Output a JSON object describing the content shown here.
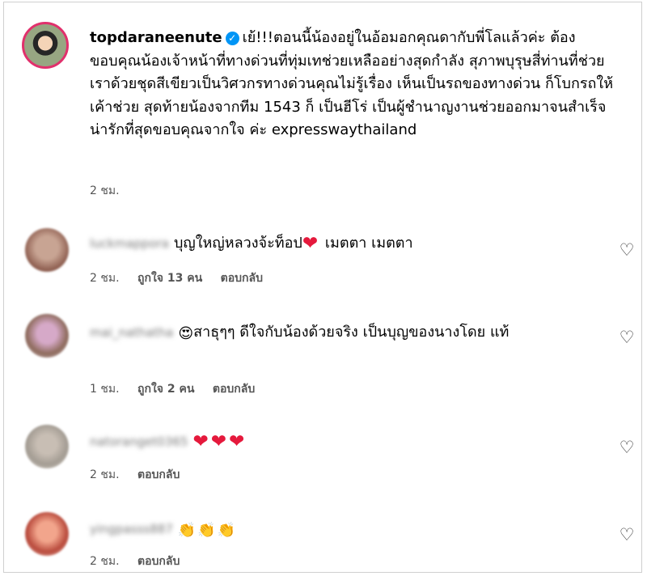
{
  "post": {
    "username": "topdaraneenute",
    "verified_icon": "check",
    "text": "เย้!!!ตอนนี้น้องอยู่ในอ้อมอกคุณดากับพี่โลแล้วค่ะ ต้องขอบคุณน้องเจ้าหน้าที่ทางด่วนที่ทุ่มเทช่วยเหลืออย่างสุดกำลัง สุภาพบุรุษสี่ท่านที่ช่วยเราด้วยชุดสีเขียวเป็นวิศวกรทางด่วนคุณไม่รู้เรื่อง เห็นเป็นรถของทางด่วน ก็โบกรถให้เค้าช่วย สุดท้ายน้องจากทีม 1543 ก็ เป็นฮีโร่ เป็นผู้ชำนาญงานช่วยออกมาจนสำเร็จ น่ารักที่สุดขอบคุณจากใจ ค่ะ expresswaythailand",
    "time": "2 ชม."
  },
  "comments": [
    {
      "blurred_username": "luckmappora",
      "text": "บุญใหญ่หลวงจ้ะท็อป",
      "suffix": " เมตตา เมตตา",
      "time": "2 ชม.",
      "likes": "ถูกใจ 13 คน",
      "reply": "ตอบกลับ"
    },
    {
      "blurred_username": "mai_nathatha",
      "text": "สาธุๆๆ ดีใจกับน้องด้วยจริง เป็นบุญของนางโดย แท้",
      "time": "1 ชม.",
      "likes": "ถูกใจ 2 คน",
      "reply": "ตอบกลับ"
    },
    {
      "blurred_username": "natoranget0365",
      "time": "2 ชม.",
      "reply": "ตอบกลับ"
    },
    {
      "blurred_username": "yingpasss887",
      "time": "2 ชม.",
      "reply": "ตอบกลับ"
    }
  ],
  "icons": {
    "like": "heart-outline-icon",
    "heart_emoji": "red-heart-icon",
    "heart_eyes": "heart-eyes-emoji-icon",
    "clap": "clapping-hands-icon"
  },
  "colors": {
    "verified": "#0095f6",
    "heart": "#e5193c",
    "meta": "#555555"
  }
}
